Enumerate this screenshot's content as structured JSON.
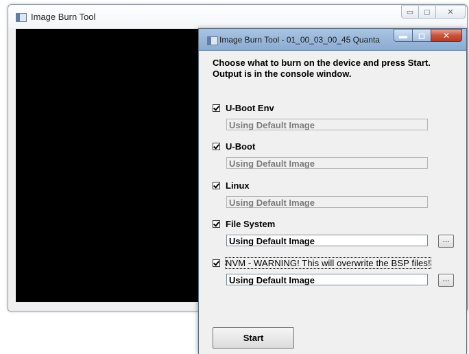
{
  "background_window": {
    "title": "Image Burn Tool",
    "controls": {
      "minimize": "▭",
      "maximize": "◻",
      "close": "✕"
    }
  },
  "dialog": {
    "title": "Image Burn Tool - 01_00_03_00_45 Quanta",
    "controls": {
      "minimize": "▬",
      "maximize": "◻",
      "close": "✕"
    },
    "instructions": "Choose what to burn on the device and press Start. Output is in the console window.",
    "options": [
      {
        "label": "U-Boot Env",
        "checked": true,
        "value": "Using Default Image",
        "enabled": false
      },
      {
        "label": "U-Boot",
        "checked": true,
        "value": "Using Default Image",
        "enabled": false
      },
      {
        "label": "Linux",
        "checked": true,
        "value": "Using Default Image",
        "enabled": false
      },
      {
        "label": "File System",
        "checked": true,
        "value": "Using Default Image",
        "enabled": true,
        "browse_label": "..."
      },
      {
        "label": "NVM - WARNING! This will overwrite the BSP files!",
        "checked": true,
        "value": "Using Default Image",
        "enabled": true,
        "browse_label": "..."
      }
    ],
    "start_label": "Start"
  },
  "colors": {
    "console_background": "#000000",
    "dialog_title_gradient": "#a9c4e3",
    "close_button": "#c9533d"
  }
}
